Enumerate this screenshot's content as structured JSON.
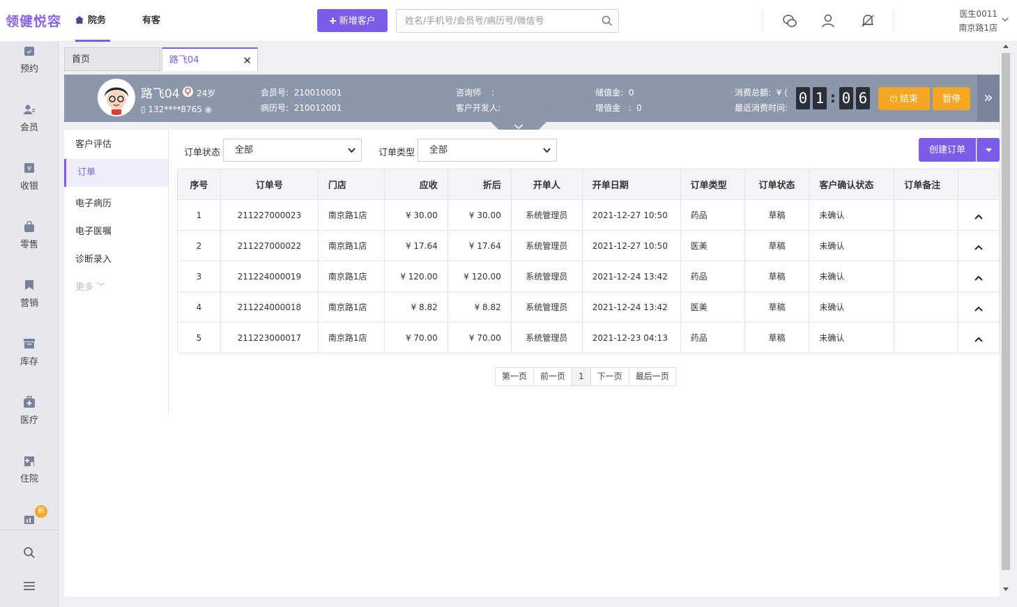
{
  "app": {
    "logo": "领健悦容",
    "nav": [
      {
        "label": "院务",
        "icon": "home-icon",
        "active": true
      },
      {
        "label": "有客",
        "active": false
      }
    ],
    "add_customer": "新增客户",
    "search_placeholder": "姓名/手机号/会员号/病历号/微信号",
    "user": {
      "name": "医生0011",
      "store": "南京路1店"
    }
  },
  "sidebar": {
    "items": [
      {
        "label": "预约",
        "icon": "calendar-icon"
      },
      {
        "label": "会员",
        "icon": "member-icon"
      },
      {
        "label": "收银",
        "icon": "cashier-icon"
      },
      {
        "label": "零售",
        "icon": "bag-icon"
      },
      {
        "label": "营销",
        "icon": "bookmark-icon"
      },
      {
        "label": "库存",
        "icon": "box-icon"
      },
      {
        "label": "医疗",
        "icon": "medical-kit-icon"
      },
      {
        "label": "住院",
        "icon": "hospital-icon"
      }
    ],
    "new_badge": "新"
  },
  "tabs": [
    {
      "label": "首页",
      "active": false
    },
    {
      "label": "路飞04",
      "active": true
    }
  ],
  "customer": {
    "name": "路飞04",
    "age": "24岁",
    "phone": "132****8765",
    "member_no_label": "会员号:",
    "member_no": "210010001",
    "record_no_label": "病历号:",
    "record_no": "210012001",
    "consultant_label": "咨询师",
    "consultant_sep": ":",
    "developer_label": "客户开发人:",
    "stored_label": "储值金:",
    "stored_value": "0",
    "bonus_label": "增值金",
    "bonus_sep": ":",
    "bonus_value": "0",
    "total_label": "消费总额:",
    "total_value": "¥ (",
    "last_label": "最近消费时间:",
    "timer": [
      "0",
      "1",
      "0",
      "6"
    ],
    "timer_sep": ":",
    "end_btn": "结束",
    "pause_btn": "暂停"
  },
  "left_menu": [
    {
      "label": "客户评估",
      "active": false
    },
    {
      "label": "订单",
      "active": true
    },
    {
      "label": "电子病历",
      "active": false
    },
    {
      "label": "电子医嘱",
      "active": false
    },
    {
      "label": "诊断录入",
      "active": false
    }
  ],
  "left_menu_more": "更多",
  "filters": {
    "status_label": "订单状态",
    "status_value": "全部",
    "type_label": "订单类型",
    "type_value": "全部"
  },
  "create_order": "创建订单",
  "table": {
    "headers": [
      "序号",
      "订单号",
      "门店",
      "应收",
      "折后",
      "开单人",
      "开单日期",
      "订单类型",
      "订单状态",
      "客户确认状态",
      "订单备注",
      ""
    ],
    "rows": [
      [
        "1",
        "211227000023",
        "南京路1店",
        "¥ 30.00",
        "¥ 30.00",
        "系统管理员",
        "2021-12-27 10:50",
        "药品",
        "草稿",
        "未确认",
        ""
      ],
      [
        "2",
        "211227000022",
        "南京路1店",
        "¥ 17.64",
        "¥ 17.64",
        "系统管理员",
        "2021-12-27 10:50",
        "医美",
        "草稿",
        "未确认",
        ""
      ],
      [
        "3",
        "211224000019",
        "南京路1店",
        "¥ 120.00",
        "¥ 120.00",
        "系统管理员",
        "2021-12-24 13:42",
        "药品",
        "草稿",
        "未确认",
        ""
      ],
      [
        "4",
        "211224000018",
        "南京路1店",
        "¥ 8.82",
        "¥ 8.82",
        "系统管理员",
        "2021-12-24 13:42",
        "医美",
        "草稿",
        "未确认",
        ""
      ],
      [
        "5",
        "211223000017",
        "南京路1店",
        "¥ 70.00",
        "¥ 70.00",
        "系统管理员",
        "2021-12-23 04:13",
        "药品",
        "草稿",
        "未确认",
        ""
      ]
    ]
  },
  "pager": {
    "first": "第一页",
    "prev": "前一页",
    "current": "1",
    "next": "下一页",
    "last": "最后一页"
  },
  "colors": {
    "accent": "#7c5ce8",
    "warning": "#f5a623",
    "banner": "#8d97ab"
  }
}
